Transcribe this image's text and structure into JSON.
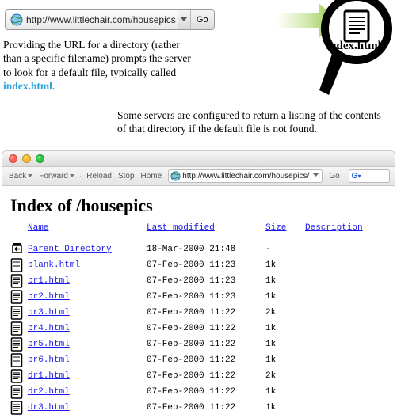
{
  "top_url": "http://www.littlechair.com/housepics",
  "go_label": "Go",
  "mag_label": "index.html",
  "caption1_a": "Providing the URL for a directory (rather than a specific filename) prompts the server to look for a default file, typically called ",
  "caption1_hl": "index.html",
  "caption1_b": ".",
  "caption2": "Some servers are configured to return a listing of the contents of that directory if the default file is not found.",
  "toolbar": {
    "back": "Back",
    "forward": "Forward",
    "reload": "Reload",
    "stop": "Stop",
    "home": "Home",
    "url": "http://www.littlechair.com/housepics/",
    "go": "Go",
    "search_placeholder": "G"
  },
  "index": {
    "title": "Index of /housepics",
    "headers": {
      "name": "Name",
      "mod": "Last modified",
      "size": "Size",
      "desc": "Description"
    },
    "parent_label": "Parent Directory",
    "parent_mod": "18-Mar-2000 21:48",
    "parent_size": "-",
    "rows": [
      {
        "name": "blank.html",
        "mod": "07-Feb-2000 11:23",
        "size": "1k"
      },
      {
        "name": "br1.html",
        "mod": "07-Feb-2000 11:23",
        "size": "1k"
      },
      {
        "name": "br2.html",
        "mod": "07-Feb-2000 11:23",
        "size": "1k"
      },
      {
        "name": "br3.html",
        "mod": "07-Feb-2000 11:22",
        "size": "2k"
      },
      {
        "name": "br4.html",
        "mod": "07-Feb-2000 11:22",
        "size": "1k"
      },
      {
        "name": "br5.html",
        "mod": "07-Feb-2000 11:22",
        "size": "1k"
      },
      {
        "name": "br6.html",
        "mod": "07-Feb-2000 11:22",
        "size": "1k"
      },
      {
        "name": "dr1.html",
        "mod": "07-Feb-2000 11:22",
        "size": "2k"
      },
      {
        "name": "dr2.html",
        "mod": "07-Feb-2000 11:22",
        "size": "1k"
      },
      {
        "name": "dr3.html",
        "mod": "07-Feb-2000 11:22",
        "size": "1k"
      }
    ]
  }
}
